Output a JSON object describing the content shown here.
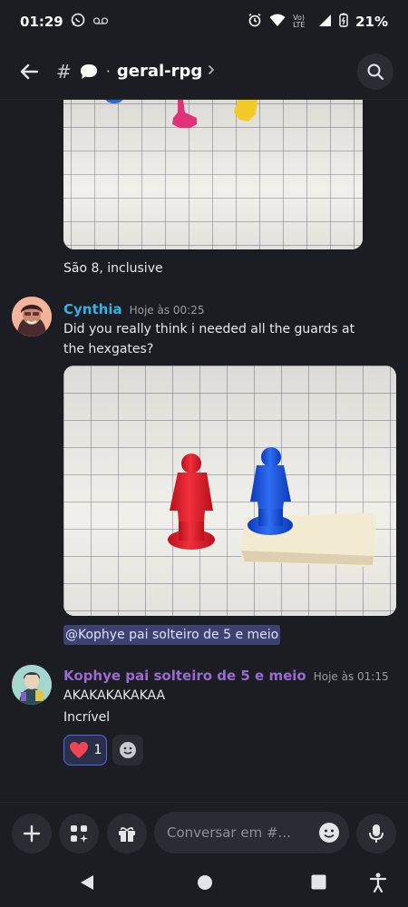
{
  "status": {
    "time": "01:29",
    "battery": "21%",
    "network_badge": "Vo) LTE"
  },
  "header": {
    "channel_name": "geral-rpg"
  },
  "messages": [
    {
      "text": "São 8, inclusive"
    },
    {
      "author": "Cynthia",
      "author_color": "#2fb4e4",
      "timestamp": "Hoje às 00:25",
      "text": "Did you really think i needed all the guards at the hexgates?",
      "mention": "@Kophye pai solteiro de 5 e meio"
    },
    {
      "author": "Kophye pai solteiro de 5 e meio",
      "author_color": "#9a6ad0",
      "timestamp": "Hoje às 01:15",
      "lines": [
        "AKAKAKAKAKAA",
        "Incrível"
      ],
      "reaction": {
        "emoji": "heart",
        "count": "1"
      }
    }
  ],
  "composer": {
    "placeholder": "Conversar em #..."
  }
}
